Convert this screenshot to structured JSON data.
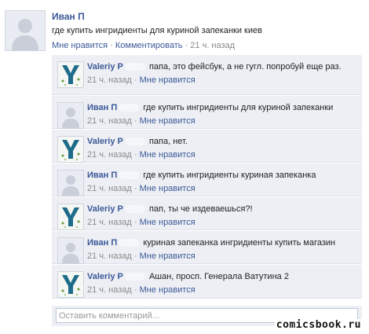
{
  "post": {
    "author": "Иван П",
    "text": "где купить ингридиенты для куриной запеканки киев",
    "like": "Мне нравится",
    "comment": "Комментировать",
    "sep1": " · ",
    "sep2": " · ",
    "time": "21 ч. назад"
  },
  "comments": [
    {
      "name": "Valeriy P",
      "text": "папа, это фейсбук, а не гугл. попробуй еще раз.",
      "time": "21 ч. назад",
      "sep": " · ",
      "like": "Мне нравится"
    },
    {
      "name": "Иван П",
      "text": "где купить ингридиенты для куриной запеканки",
      "time": "21 ч. назад",
      "sep": " · ",
      "like": "Мне нравится"
    },
    {
      "name": "Valeriy P",
      "text": "папа, нет.",
      "time": "21 ч. назад",
      "sep": " · ",
      "like": "Мне нравится"
    },
    {
      "name": "Иван П",
      "text": "где купить ингридиенты куриная запеканка",
      "time": "21 ч. назад",
      "sep": " · ",
      "like": "Мне нравится"
    },
    {
      "name": "Valeriy P",
      "text": "пап, ты че издеваешься?!",
      "time": "21 ч. назад",
      "sep": " · ",
      "like": "Мне нравится"
    },
    {
      "name": "Иван П",
      "text": "куриная запеканка ингридиенты купить магазин",
      "time": "21 ч. назад",
      "sep": " · ",
      "like": "Мне нравится"
    },
    {
      "name": "Valeriy P",
      "text": "Ашан, просп. Генерала Ватутина 2",
      "time": "21 ч. назад",
      "sep": " · ",
      "like": "Мне нравится"
    }
  ],
  "input": {
    "placeholder": "Оставить комментарий..."
  },
  "watermark": "comicsbook.ru",
  "colors": {
    "link": "#3b5998",
    "comment_bg": "#edeff4",
    "meta": "#8a8a8a"
  },
  "icons": {
    "default_avatar": "person-silhouette-icon",
    "y_avatar": "y-logo-icon"
  }
}
